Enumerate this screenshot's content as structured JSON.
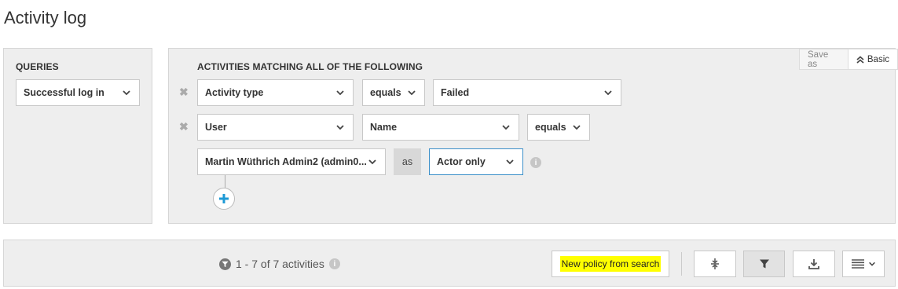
{
  "page": {
    "title": "Activity log"
  },
  "queries": {
    "heading": "QUERIES",
    "selected": "Successful log in"
  },
  "filters": {
    "heading": "ACTIVITIES MATCHING ALL OF THE FOLLOWING",
    "save_as_label": "Save as",
    "basic_label": "Basic",
    "rows": [
      {
        "field": "Activity type",
        "operator": "equals",
        "value": "Failed"
      },
      {
        "field": "User",
        "subfield": "Name",
        "operator": "equals"
      },
      {
        "value": "Martin Wüthrich Admin2 (admin0...",
        "as_label": "as",
        "role": "Actor only"
      }
    ]
  },
  "results": {
    "count_text": "1 - 7 of 7 activities",
    "new_policy_label": "New policy from search"
  },
  "colors": {
    "highlight": "#ffff00",
    "accent": "#3b8fc9",
    "panel_bg": "#eeeeee"
  }
}
